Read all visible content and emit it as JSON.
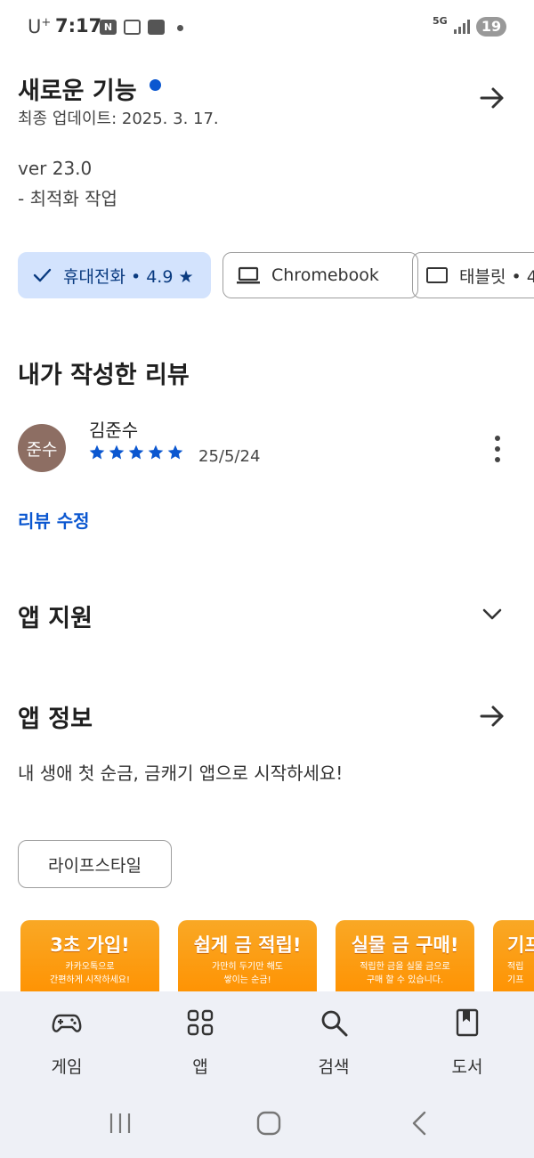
{
  "status_bar": {
    "carrier": "U",
    "carrier_sup": "+",
    "time": "7:17",
    "network": "5G",
    "battery": "19"
  },
  "whats_new": {
    "title": "새로운 기능",
    "updated": "최종 업데이트: 2025. 3. 17.",
    "version": "ver 23.0",
    "note": "- 최적화 작업"
  },
  "devices": [
    {
      "label": "휴대전화 • 4.9 ★",
      "selected": true,
      "icon": "check-icon"
    },
    {
      "label": "Chromebook",
      "selected": false,
      "icon": "laptop-icon"
    },
    {
      "label": "태블릿 • 4",
      "selected": false,
      "icon": "tablet-icon"
    }
  ],
  "my_review": {
    "title": "내가 작성한 리뷰",
    "avatar_text": "준수",
    "name": "김준수",
    "rating": 5,
    "date": "25/5/24",
    "edit_label": "리뷰 수정"
  },
  "app_support": {
    "title": "앱 지원"
  },
  "app_info": {
    "title": "앱 정보",
    "description": "내 생애 첫 순금, 금캐기 앱으로 시작하세요!",
    "category": "라이프스타일"
  },
  "screenshots": [
    {
      "heading": "3초 가입!",
      "line1": "카카오톡으로",
      "line2": "간편하게 시작하세요!"
    },
    {
      "heading": "쉽게 금 적립!",
      "line1": "가만히 두기만 해도",
      "line2": "쌓이는 순금!"
    },
    {
      "heading": "실물 금 구매!",
      "line1": "적립한 금을 실물 금으로",
      "line2": "구매 할 수 있습니다."
    },
    {
      "heading": "기프",
      "line1": "적립",
      "line2": "기프"
    }
  ],
  "bottom_nav": [
    {
      "label": "게임",
      "icon": "gamepad-icon"
    },
    {
      "label": "앱",
      "icon": "apps-grid-icon"
    },
    {
      "label": "검색",
      "icon": "search-icon"
    },
    {
      "label": "도서",
      "icon": "book-icon"
    }
  ],
  "colors": {
    "accent": "#0b57d0",
    "chip_selected_bg": "#d3e3fd",
    "avatar_bg": "#8d6e63",
    "nav_bg": "#eef0f6",
    "shot_orange": "#ff9d00"
  }
}
